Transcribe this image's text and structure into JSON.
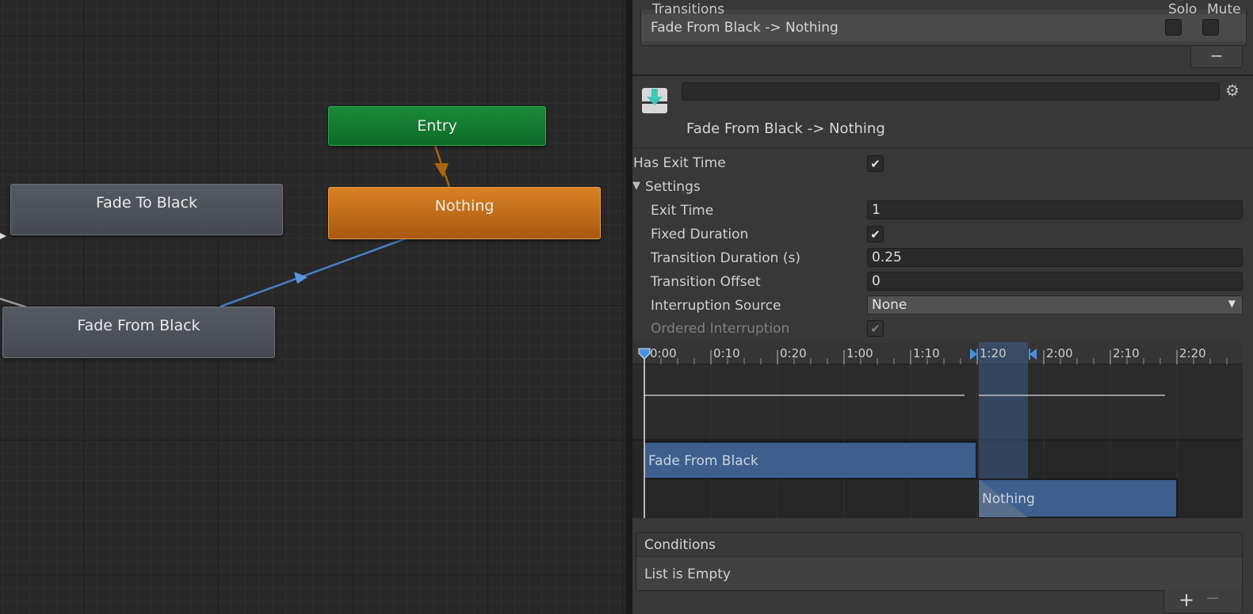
{
  "graph": {
    "nodes": {
      "entry": "Entry",
      "nothing": "Nothing",
      "fade_to_black": "Fade To Black",
      "fade_from_black": "Fade From Black"
    },
    "colors": {
      "entry": "#127a33",
      "default_state": "#c56d1a",
      "state": "#4e5258",
      "transition": "#4a7fc8"
    }
  },
  "inspector": {
    "transitions_header": "Transitions",
    "solo_label": "Solo",
    "mute_label": "Mute",
    "transition_row": "Fade From Black -> Nothing",
    "minus_symbol": "−",
    "title": "Fade From Black -> Nothing",
    "properties": {
      "has_exit_time": "Has Exit Time",
      "settings": "Settings",
      "exit_time": "Exit Time",
      "exit_time_value": "1",
      "fixed_duration": "Fixed Duration",
      "transition_duration": "Transition Duration (s)",
      "transition_duration_value": "0.25",
      "transition_offset": "Transition Offset",
      "transition_offset_value": "0",
      "interruption_source": "Interruption Source",
      "interruption_source_value": "None",
      "ordered_interruption": "Ordered Interruption"
    },
    "timeline": {
      "ticks": [
        "0:00",
        "0:10",
        "0:20",
        "1:00",
        "1:10",
        "1:20",
        "2:00",
        "2:10",
        "2:20"
      ],
      "source_clip": "Fade From Black",
      "target_clip": "Nothing"
    },
    "conditions": {
      "title": "Conditions",
      "empty_text": "List is Empty",
      "plus": "+",
      "minus": "−"
    }
  }
}
